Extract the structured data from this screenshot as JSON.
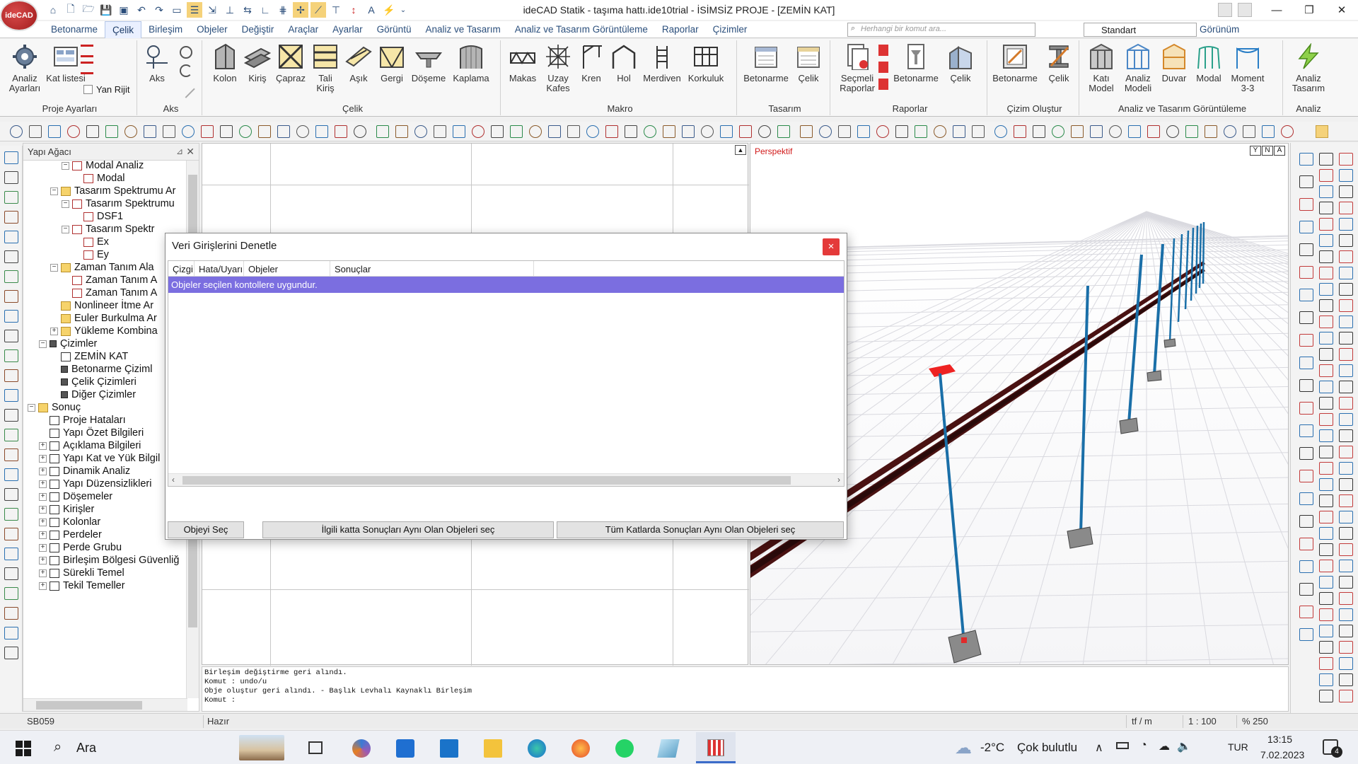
{
  "window": {
    "title": "ideCAD Statik - taşıma hattı.ide10trial - İSİMSİZ PROJE - [ZEMİN KAT]",
    "logo_text": "ideCAD"
  },
  "menu": {
    "tabs": [
      "Betonarme",
      "Çelik",
      "Birleşim",
      "Objeler",
      "Değiştir",
      "Araçlar",
      "Ayarlar",
      "Görüntü",
      "Analiz ve Tasarım",
      "Analiz ve Tasarım Görüntüleme",
      "Raporlar",
      "Çizimler"
    ],
    "active_tab": "Çelik",
    "search_placeholder": "Herhangi bir komut ara...",
    "style_select": "Standart",
    "view_label": "Görünüm"
  },
  "ribbon": {
    "groups": [
      {
        "label": "Proje Ayarları"
      },
      {
        "label": "Aks"
      },
      {
        "label": "Çelik"
      },
      {
        "label": "Makro"
      },
      {
        "label": "Tasarım"
      },
      {
        "label": "Raporlar"
      },
      {
        "label": "Çizim Oluştur"
      },
      {
        "label": "Analiz ve Tasarım Görüntüleme"
      },
      {
        "label": "Analiz"
      }
    ],
    "buttons": {
      "analiz_ayarlari": "Analiz Ayarları",
      "kat_listesi": "Kat listesi",
      "yan_rijit": "Yan Rijit",
      "aks": "Aks",
      "kolon": "Kolon",
      "kiris": "Kiriş",
      "capraz": "Çapraz",
      "tali_kiris": "Tali Kiriş",
      "asik": "Aşık",
      "gergi": "Gergi",
      "doseme": "Döşeme",
      "kaplama": "Kaplama",
      "makas": "Makas",
      "uzay_kafes": "Uzay Kafes",
      "kren": "Kren",
      "hol": "Hol",
      "merdiven": "Merdiven",
      "korkuluk": "Korkuluk",
      "tasarim_betonarme": "Betonarme",
      "tasarim_celik": "Çelik",
      "secmeli_raporlar": "Seçmeli Raporlar",
      "rapor_betonarme": "Betonarme",
      "rapor_celik": "Çelik",
      "cizim_betonarme": "Betonarme",
      "cizim_celik": "Çelik",
      "kati_model": "Katı Model",
      "analiz_modeli": "Analiz Modeli",
      "duvar": "Duvar",
      "modal": "Modal",
      "moment": "Moment 3-3",
      "analiz_tasarim": "Analiz Tasarım"
    }
  },
  "tree": {
    "title": "Yapı Ağacı",
    "nodes": [
      {
        "label": "Modal Analiz",
        "icon": "graph",
        "expand": "−",
        "level": 3
      },
      {
        "label": "Modal",
        "icon": "graph",
        "expand": "",
        "level": 4
      },
      {
        "label": "Tasarım Spektrumu Ar",
        "icon": "folder",
        "expand": "−",
        "level": 2
      },
      {
        "label": "Tasarım Spektrumu",
        "icon": "graph",
        "expand": "−",
        "level": 3
      },
      {
        "label": "DSF1",
        "icon": "graph",
        "expand": "",
        "level": 4
      },
      {
        "label": "Tasarım Spektr",
        "icon": "graph",
        "expand": "−",
        "level": 3
      },
      {
        "label": "Ex",
        "icon": "graph",
        "expand": "",
        "level": 4
      },
      {
        "label": "Ey",
        "icon": "graph",
        "expand": "",
        "level": 4
      },
      {
        "label": "Zaman Tanım Ala",
        "icon": "folder",
        "expand": "−",
        "level": 2
      },
      {
        "label": "Zaman Tanım A",
        "icon": "graph",
        "expand": "",
        "level": 3
      },
      {
        "label": "Zaman Tanım A",
        "icon": "graph",
        "expand": "",
        "level": 3
      },
      {
        "label": "Nonlineer İtme Ar",
        "icon": "folder",
        "expand": "",
        "level": 2
      },
      {
        "label": "Euler Burkulma Ar",
        "icon": "folder",
        "expand": "",
        "level": 2
      },
      {
        "label": "Yükleme Kombina",
        "icon": "folder",
        "expand": "+",
        "level": 2
      },
      {
        "label": "Çizimler",
        "icon": "ink",
        "expand": "−",
        "level": 1
      },
      {
        "label": "ZEMİN KAT",
        "icon": "doc",
        "expand": "",
        "level": 2
      },
      {
        "label": "Betonarme Çiziml",
        "icon": "ink",
        "expand": "",
        "level": 2
      },
      {
        "label": "Çelik Çizimleri",
        "icon": "ink",
        "expand": "",
        "level": 2
      },
      {
        "label": "Diğer Çizimler",
        "icon": "ink",
        "expand": "",
        "level": 2
      },
      {
        "label": "Sonuç",
        "icon": "folder",
        "expand": "−",
        "level": 0
      },
      {
        "label": "Proje Hataları",
        "icon": "doc",
        "expand": "",
        "level": 1
      },
      {
        "label": "Yapı Özet Bilgileri",
        "icon": "doc",
        "expand": "",
        "level": 1
      },
      {
        "label": "Açıklama Bilgileri",
        "icon": "doc",
        "expand": "+",
        "level": 1
      },
      {
        "label": "Yapı Kat ve Yük Bilgil",
        "icon": "doc",
        "expand": "+",
        "level": 1
      },
      {
        "label": "Dinamik Analiz",
        "icon": "doc",
        "expand": "+",
        "level": 1
      },
      {
        "label": "Yapı Düzensizlikleri",
        "icon": "doc",
        "expand": "+",
        "level": 1
      },
      {
        "label": "Döşemeler",
        "icon": "doc",
        "expand": "+",
        "level": 1
      },
      {
        "label": "Kirişler",
        "icon": "doc",
        "expand": "+",
        "level": 1
      },
      {
        "label": "Kolonlar",
        "icon": "doc",
        "expand": "+",
        "level": 1
      },
      {
        "label": "Perdeler",
        "icon": "doc",
        "expand": "+",
        "level": 1
      },
      {
        "label": "Perde Grubu",
        "icon": "doc",
        "expand": "+",
        "level": 1
      },
      {
        "label": "Birleşim Bölgesi Güvenliğ",
        "icon": "doc",
        "expand": "+",
        "level": 1
      },
      {
        "label": "Sürekli Temel",
        "icon": "doc",
        "expand": "+",
        "level": 1
      },
      {
        "label": "Tekil Temeller",
        "icon": "doc",
        "expand": "+",
        "level": 1
      }
    ]
  },
  "viewport": {
    "persp_label": "Perspektif",
    "persp_ctrls": [
      "Y",
      "N",
      "A"
    ]
  },
  "dialog": {
    "title": "Veri Girişlerini Denetle",
    "close": "×",
    "columns": [
      "Çizgi",
      "Hata/Uyarı",
      "Objeler",
      "Sonuçlar"
    ],
    "row_text": "Objeler seçilen kontollere uygundur.",
    "buttons": [
      "Objeyi Seç",
      "İlgili katta Sonuçları Aynı Olan Objeleri seç",
      "Tüm Katlarda Sonuçları Aynı Olan Objeleri seç"
    ]
  },
  "command_log": {
    "lines": [
      "Birleşim değiştirme geri alındı.",
      "Komut : undo/u",
      "Obje oluştur geri alındı. - Başlık Levhalı Kaynaklı Birleşim",
      "Komut :"
    ]
  },
  "status": {
    "code": "SB059",
    "state": "Hazır",
    "units": "tf / m",
    "scale": "1 : 100",
    "zoom": "% 250"
  },
  "taskbar": {
    "search_label": "Ara",
    "weather_temp": "-2°C",
    "weather_text": "Çok bulutlu",
    "language": "TUR",
    "time": "13:15",
    "date": "7.02.2023",
    "notification_count": "4"
  },
  "colors": {
    "accent_red": "#d11a1a",
    "selection": "#7b6ee0",
    "close_button": "#e43a3a"
  }
}
